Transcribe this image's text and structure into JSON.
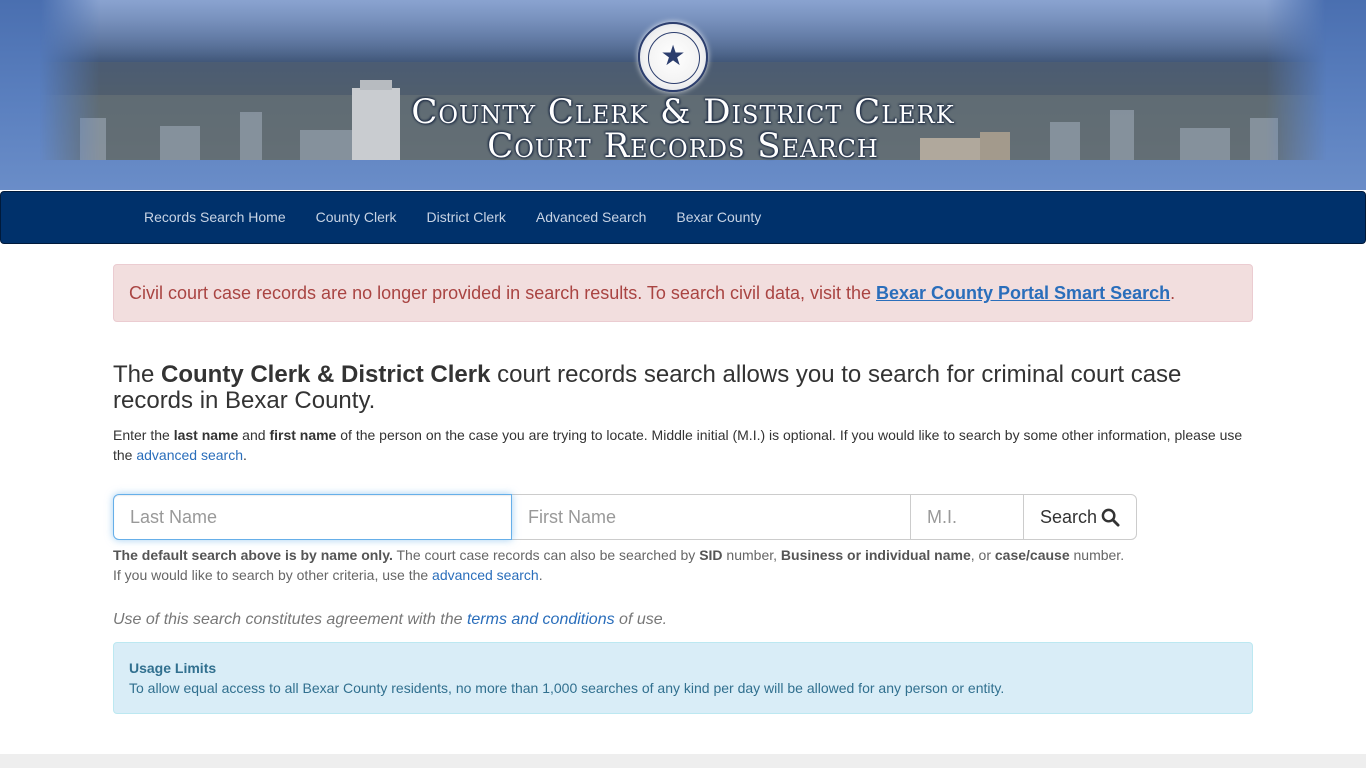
{
  "banner": {
    "title_line1": "County Clerk & District Clerk",
    "title_line2": "Court Records Search",
    "seal_icon": "texas-seal-star"
  },
  "nav": {
    "items": [
      {
        "label": "Records Search Home"
      },
      {
        "label": "County Clerk"
      },
      {
        "label": "District Clerk"
      },
      {
        "label": "Advanced Search"
      },
      {
        "label": "Bexar County"
      }
    ]
  },
  "alert": {
    "text": "Civil court case records are no longer provided in search results. To search civil data, visit the ",
    "link": "Bexar County Portal Smart Search",
    "suffix": "."
  },
  "lead": {
    "prefix": "The ",
    "bold": "County Clerk & District Clerk",
    "suffix": " court records search allows you to search for criminal court case records in Bexar County."
  },
  "intro": {
    "t1": "Enter the ",
    "b1": "last name",
    "t2": " and ",
    "b2": "first name",
    "t3": " of the person on the case you are trying to locate. Middle initial (M.I.) is optional. If you would like to search by some other information, please use the ",
    "link": "advanced search",
    "t4": "."
  },
  "search": {
    "last_placeholder": "Last Name",
    "first_placeholder": "First Name",
    "mi_placeholder": "M.I.",
    "button_label": "Search",
    "button_icon": "search-icon"
  },
  "note": {
    "b1": "The default search above is by name only.",
    "t1": " The court case records can also be searched by ",
    "b2": "SID",
    "t2": " number, ",
    "b3": "Business or individual name",
    "t3": ", or ",
    "b4": "case/cause",
    "t4": " number.",
    "t5": "If you would like to search by other criteria, use the ",
    "link": "advanced search",
    "t6": "."
  },
  "terms": {
    "t1": "Use of this search constitutes agreement with the ",
    "link": "terms and conditions",
    "t2": " of use."
  },
  "usage": {
    "title": "Usage Limits",
    "text": "To allow equal access to all Bexar County residents, no more than 1,000 searches of any kind per day will be allowed for any person or entity."
  },
  "colors": {
    "navbar": "#00316b",
    "link": "#2a6ebb",
    "danger_bg": "#f2dede",
    "info_bg": "#d9edf7"
  }
}
